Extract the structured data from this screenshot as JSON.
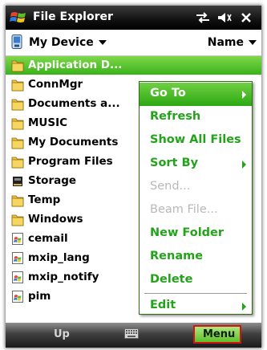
{
  "title_bar": {
    "title": "File Explorer",
    "icons": [
      "start-logo-icon",
      "connectivity-icon",
      "volume-icon",
      "close-icon"
    ]
  },
  "location_bar": {
    "location": "My Device",
    "sort": "Name"
  },
  "files": [
    {
      "name": "Application D...",
      "type": "folder",
      "selected": true
    },
    {
      "name": "ConnMgr",
      "type": "folder"
    },
    {
      "name": "Documents a...",
      "type": "folder"
    },
    {
      "name": "MUSIC",
      "type": "folder"
    },
    {
      "name": "My Documents",
      "type": "folder"
    },
    {
      "name": "Program Files",
      "type": "folder"
    },
    {
      "name": "Storage",
      "type": "storage"
    },
    {
      "name": "Temp",
      "type": "folder"
    },
    {
      "name": "Windows",
      "type": "folder"
    },
    {
      "name": "cemail",
      "type": "file"
    },
    {
      "name": "mxip_lang",
      "type": "file"
    },
    {
      "name": "mxip_notify",
      "type": "file"
    },
    {
      "name": "pim",
      "type": "file"
    }
  ],
  "context_menu": {
    "items": [
      {
        "label": "Go To",
        "submenu": true,
        "highlighted": true
      },
      {
        "label": "Refresh"
      },
      {
        "label": "Show All Files"
      },
      {
        "label": "Sort By",
        "submenu": true
      },
      {
        "label": "Send...",
        "disabled": true
      },
      {
        "label": "Beam File...",
        "disabled": true
      },
      {
        "label": "New Folder"
      },
      {
        "label": "Rename"
      },
      {
        "label": "Delete"
      },
      {
        "label": "Edit",
        "submenu": true
      }
    ]
  },
  "soft_keys": {
    "left": "Up",
    "right": "Menu"
  },
  "colors": {
    "accent_green": "#23a31a",
    "highlight_green": "#4cbf26",
    "menu_button_border": "#d11515"
  }
}
